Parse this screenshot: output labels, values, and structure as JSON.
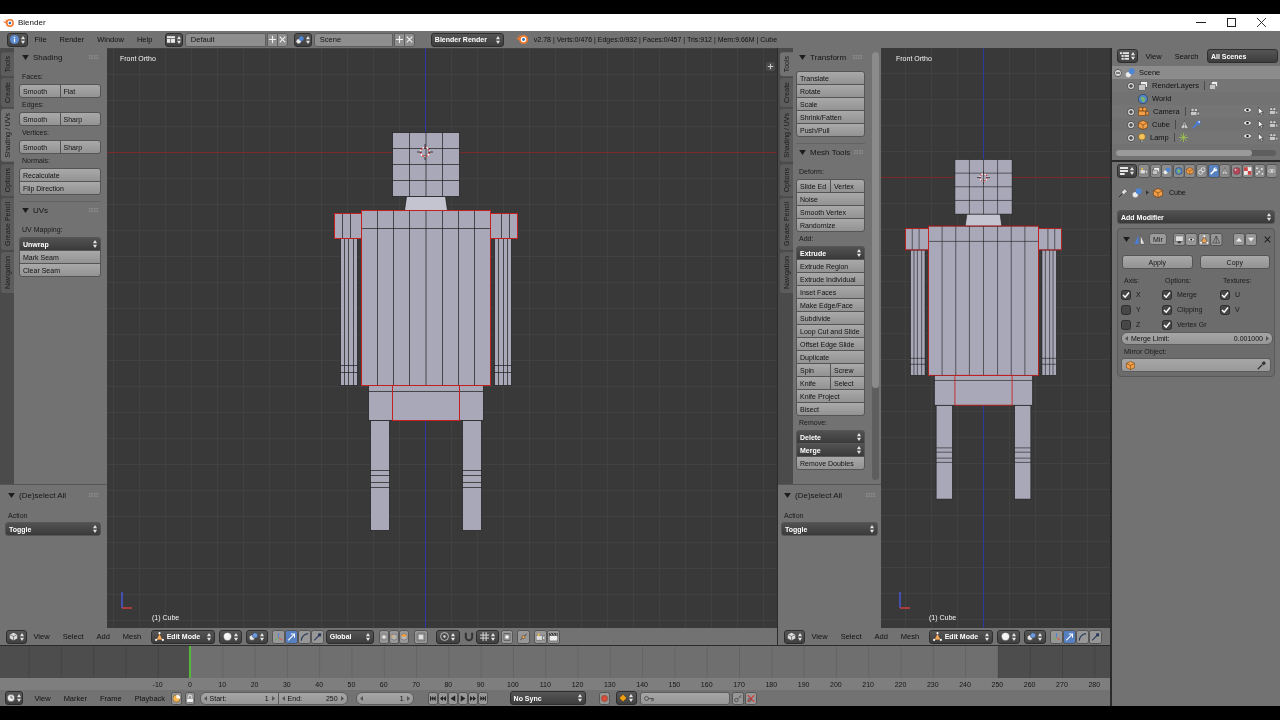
{
  "window": {
    "title": "Blender"
  },
  "info_header": {
    "menus": [
      "File",
      "Render",
      "Window",
      "Help"
    ],
    "screen_layout": "Default",
    "scene": "Scene",
    "render_engine": "Blender Render",
    "stats": "v2.78 | Verts:0/476 | Edges:0/932 | Faces:0/457 | Tris:912 | Mem:9.66M | Cube"
  },
  "views": [
    {
      "tabs": [
        {
          "label": "Tools",
          "selected": false
        },
        {
          "label": "Create",
          "selected": false
        },
        {
          "label": "Shading / UVs",
          "selected": true
        },
        {
          "label": "Options",
          "selected": false
        },
        {
          "label": "Grease Pencil",
          "selected": false
        },
        {
          "label": "Navigation",
          "selected": false
        }
      ],
      "panels": [
        {
          "title": "Shading",
          "expanded": true,
          "items": [
            {
              "kind": "label",
              "text": "Faces:"
            },
            {
              "kind": "group",
              "rows": [
                [
                  {
                    "kind": "button",
                    "text": "Smooth"
                  },
                  {
                    "kind": "button",
                    "text": "Flat"
                  }
                ]
              ]
            },
            {
              "kind": "label",
              "text": "Edges:"
            },
            {
              "kind": "group",
              "rows": [
                [
                  {
                    "kind": "button",
                    "text": "Smooth"
                  },
                  {
                    "kind": "button",
                    "text": "Sharp"
                  }
                ]
              ]
            },
            {
              "kind": "label",
              "text": "Vertices:"
            },
            {
              "kind": "group",
              "rows": [
                [
                  {
                    "kind": "button",
                    "text": "Smooth"
                  },
                  {
                    "kind": "button",
                    "text": "Sharp"
                  }
                ]
              ]
            },
            {
              "kind": "label",
              "text": "Normals:"
            },
            {
              "kind": "group",
              "rows": [
                [
                  {
                    "kind": "button",
                    "text": "Recalculate"
                  }
                ],
                [
                  {
                    "kind": "button",
                    "text": "Flip Direction"
                  }
                ]
              ]
            }
          ]
        },
        {
          "title": "UVs",
          "expanded": true,
          "items": [
            {
              "kind": "label",
              "text": "UV Mapping:"
            },
            {
              "kind": "group",
              "rows": [
                [
                  {
                    "kind": "menu",
                    "text": "Unwrap"
                  }
                ],
                [
                  {
                    "kind": "button",
                    "text": "Mark Seam"
                  }
                ],
                [
                  {
                    "kind": "button",
                    "text": "Clear Seam"
                  }
                ]
              ]
            }
          ]
        }
      ],
      "operator": {
        "title": "(De)select All",
        "expanded": true,
        "label": "Action",
        "value": "Toggle"
      },
      "viewport": {
        "view_name": "Front Ortho",
        "object_label": "(1) Cube"
      },
      "header": {
        "menus": [
          "View",
          "Select",
          "Add",
          "Mesh"
        ],
        "mode": "Edit Mode",
        "manipulators": [
          {
            "kind": "axes",
            "selected": false
          },
          {
            "kind": "translate",
            "selected": true
          },
          {
            "kind": "rotate",
            "selected": false
          },
          {
            "kind": "scale",
            "selected": false
          }
        ],
        "orientation": "Global"
      }
    },
    {
      "tabs": [
        {
          "label": "Tools",
          "selected": true
        },
        {
          "label": "Create",
          "selected": false
        },
        {
          "label": "Shading / UVs",
          "selected": false
        },
        {
          "label": "Options",
          "selected": false
        },
        {
          "label": "Grease Pencil",
          "selected": false
        },
        {
          "label": "Navigation",
          "selected": false
        }
      ],
      "panels": [
        {
          "title": "Transform",
          "expanded": true,
          "items": [
            {
              "kind": "group",
              "rows": [
                [
                  {
                    "kind": "button",
                    "text": "Translate"
                  }
                ],
                [
                  {
                    "kind": "button",
                    "text": "Rotate"
                  }
                ],
                [
                  {
                    "kind": "button",
                    "text": "Scale"
                  }
                ],
                [
                  {
                    "kind": "button",
                    "text": "Shrink/Fatten"
                  }
                ],
                [
                  {
                    "kind": "button",
                    "text": "Push/Pull"
                  }
                ]
              ]
            }
          ]
        },
        {
          "title": "Mesh Tools",
          "expanded": true,
          "items": [
            {
              "kind": "label",
              "text": "Deform:"
            },
            {
              "kind": "group",
              "rows": [
                [
                  {
                    "kind": "button",
                    "text": "Slide Ed"
                  },
                  {
                    "kind": "button",
                    "text": "Vertex"
                  }
                ],
                [
                  {
                    "kind": "button",
                    "text": "Noise"
                  }
                ],
                [
                  {
                    "kind": "button",
                    "text": "Smooth Vertex"
                  }
                ],
                [
                  {
                    "kind": "button",
                    "text": "Randomize"
                  }
                ]
              ]
            },
            {
              "kind": "label",
              "text": "Add:"
            },
            {
              "kind": "group",
              "rows": [
                [
                  {
                    "kind": "menu",
                    "text": "Extrude"
                  }
                ],
                [
                  {
                    "kind": "button",
                    "text": "Extrude Region"
                  }
                ],
                [
                  {
                    "kind": "button",
                    "text": "Extrude Individual"
                  }
                ],
                [
                  {
                    "kind": "button",
                    "text": "Inset Faces"
                  }
                ],
                [
                  {
                    "kind": "button",
                    "text": "Make Edge/Face"
                  }
                ],
                [
                  {
                    "kind": "button",
                    "text": "Subdivide"
                  }
                ],
                [
                  {
                    "kind": "button",
                    "text": "Loop Cut and Slide"
                  }
                ],
                [
                  {
                    "kind": "button",
                    "text": "Offset Edge Slide"
                  }
                ],
                [
                  {
                    "kind": "button",
                    "text": "Duplicate"
                  }
                ],
                [
                  {
                    "kind": "button",
                    "text": "Spin"
                  },
                  {
                    "kind": "button",
                    "text": "Screw"
                  }
                ],
                [
                  {
                    "kind": "button",
                    "text": "Knife"
                  },
                  {
                    "kind": "button",
                    "text": "Select"
                  }
                ],
                [
                  {
                    "kind": "button",
                    "text": "Knife Project"
                  }
                ],
                [
                  {
                    "kind": "button",
                    "text": "Bisect"
                  }
                ]
              ]
            },
            {
              "kind": "label",
              "text": "Remove:"
            },
            {
              "kind": "group",
              "rows": [
                [
                  {
                    "kind": "menu",
                    "text": "Delete"
                  }
                ],
                [
                  {
                    "kind": "menu",
                    "text": "Merge"
                  }
                ],
                [
                  {
                    "kind": "button",
                    "text": "Remove Doubles"
                  }
                ]
              ]
            }
          ]
        }
      ],
      "operator": {
        "title": "(De)select All",
        "expanded": true,
        "label": "Action",
        "value": "Toggle"
      },
      "viewport": {
        "view_name": "Front Ortho",
        "object_label": "(1) Cube"
      },
      "header": {
        "menus": [
          "View",
          "Select",
          "Add",
          "Mesh"
        ],
        "mode": "Edit Mode",
        "manipulators": [
          {
            "kind": "axes",
            "selected": false
          },
          {
            "kind": "translate",
            "selected": true
          },
          {
            "kind": "rotate",
            "selected": false
          },
          {
            "kind": "scale",
            "selected": false
          }
        ]
      }
    }
  ],
  "outliner": {
    "menus": [
      "View",
      "Search"
    ],
    "filter": "All Scenes",
    "tree": [
      {
        "name": "Scene",
        "kind": "scene",
        "selected": true,
        "expanded": true,
        "children": [
          {
            "name": "RenderLayers",
            "kind": "render_layers",
            "selected": false,
            "expanded": false
          },
          {
            "name": "World",
            "kind": "world",
            "selected": false
          },
          {
            "name": "Camera",
            "kind": "camera",
            "selected": false,
            "expanded": false
          },
          {
            "name": "Cube",
            "kind": "mesh",
            "selected": false,
            "expanded": false
          },
          {
            "name": "Lamp",
            "kind": "lamp",
            "selected": false,
            "expanded": false
          }
        ]
      }
    ]
  },
  "properties": {
    "tabs": [
      {
        "kind": "render",
        "selected": false
      },
      {
        "kind": "render_layers",
        "selected": false
      },
      {
        "kind": "scene",
        "selected": false
      },
      {
        "kind": "world",
        "selected": false
      },
      {
        "kind": "object",
        "selected": false
      },
      {
        "kind": "constraints",
        "selected": false
      },
      {
        "kind": "modifiers",
        "selected": true
      },
      {
        "kind": "data",
        "selected": false
      },
      {
        "kind": "material",
        "selected": false
      },
      {
        "kind": "texture",
        "selected": false
      },
      {
        "kind": "particles",
        "selected": false
      },
      {
        "kind": "physics",
        "selected": false
      }
    ],
    "breadcrumb": "Cube",
    "add_modifier": "Add Modifier",
    "modifier": {
      "name": "Mir",
      "expanded": true,
      "buttons": [
        "Apply",
        "Copy"
      ],
      "columns": [
        {
          "title": "Axis:",
          "options": [
            {
              "label": "X",
              "checked": true
            },
            {
              "label": "Y",
              "checked": false
            },
            {
              "label": "Z",
              "checked": false
            }
          ]
        },
        {
          "title": "Options:",
          "options": [
            {
              "label": "Merge",
              "checked": true
            },
            {
              "label": "Clipping",
              "checked": true
            },
            {
              "label": "Vertex Gr",
              "checked": true
            }
          ]
        },
        {
          "title": "Textures:",
          "options": [
            {
              "label": "U",
              "checked": true
            },
            {
              "label": "V",
              "checked": true
            }
          ]
        }
      ],
      "merge_limit": {
        "label": "Merge Limit:",
        "value": "0.001000"
      },
      "mirror_object": {
        "label": "Mirror Object:"
      }
    }
  },
  "timeline": {
    "ruler": [
      "-10",
      "0",
      "10",
      "20",
      "30",
      "40",
      "50",
      "60",
      "70",
      "80",
      "90",
      "100",
      "110",
      "120",
      "130",
      "140",
      "150",
      "160",
      "170",
      "180",
      "190",
      "200",
      "210",
      "220",
      "230",
      "240",
      "250",
      "260",
      "270",
      "280"
    ],
    "header": {
      "menus": [
        "View",
        "Marker",
        "Frame",
        "Playback"
      ],
      "start": {
        "label": "Start:",
        "value": "1"
      },
      "end": {
        "label": "End:",
        "value": "250"
      },
      "current_frame": "1",
      "sync": "No Sync"
    }
  }
}
